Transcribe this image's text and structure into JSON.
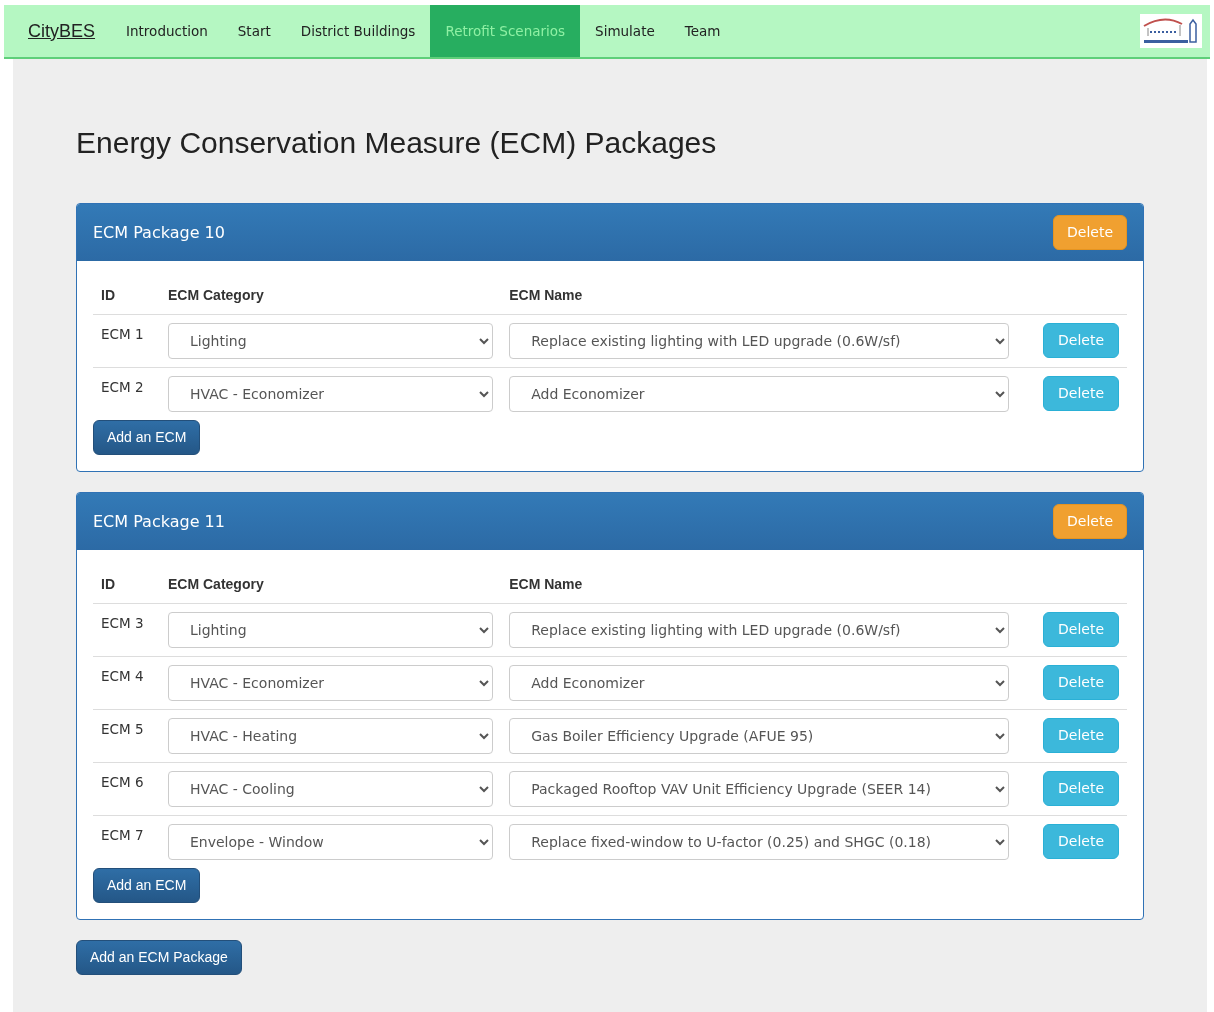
{
  "navbar": {
    "brand": "CityBES",
    "items": [
      {
        "label": "Introduction",
        "selected": false
      },
      {
        "label": "Start",
        "selected": false
      },
      {
        "label": "District Buildings",
        "selected": false
      },
      {
        "label": "Retrofit Scenarios",
        "selected": true
      },
      {
        "label": "Simulate",
        "selected": false
      },
      {
        "label": "Team",
        "selected": false
      }
    ]
  },
  "title": "Energy Conservation Measure (ECM) Packages",
  "packages": [
    {
      "title": "ECM Package 10",
      "delete_button": "Delete",
      "columns": [
        "ID",
        "ECM Category",
        "ECM Name"
      ],
      "rows": [
        {
          "id": "ECM 1",
          "category": "Lighting",
          "name": "Replace existing lighting with LED upgrade (0.6W/sf)",
          "delete_button": "Delete"
        },
        {
          "id": "ECM 2",
          "category": "HVAC - Economizer",
          "name": "Add Economizer",
          "delete_button": "Delete"
        }
      ],
      "add_button": "Add an ECM"
    },
    {
      "title": "ECM Package 11",
      "delete_button": "Delete",
      "columns": [
        "ID",
        "ECM Category",
        "ECM Name"
      ],
      "rows": [
        {
          "id": "ECM 3",
          "category": "Lighting",
          "name": "Replace existing lighting with LED upgrade (0.6W/sf)",
          "delete_button": "Delete"
        },
        {
          "id": "ECM 4",
          "category": "HVAC - Economizer",
          "name": "Add Economizer",
          "delete_button": "Delete"
        },
        {
          "id": "ECM 5",
          "category": "HVAC - Heating",
          "name": "Gas Boiler Efficiency Upgrade (AFUE 95)",
          "delete_button": "Delete"
        },
        {
          "id": "ECM 6",
          "category": "HVAC - Cooling",
          "name": "Packaged Rooftop VAV Unit Efficiency Upgrade (SEER 14)",
          "delete_button": "Delete"
        },
        {
          "id": "ECM 7",
          "category": "Envelope - Window",
          "name": "Replace fixed-window to U-factor (0.25) and SHGC (0.18)",
          "delete_button": "Delete"
        }
      ],
      "add_button": "Add an ECM"
    }
  ],
  "add_package_button": "Add an ECM Package"
}
